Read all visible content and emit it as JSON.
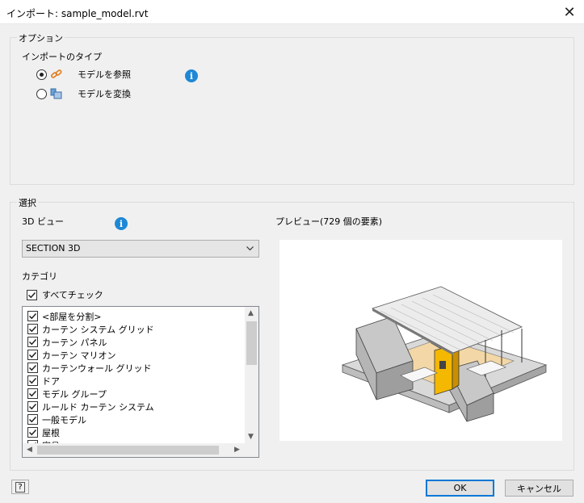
{
  "window": {
    "title": "インポート: sample_model.rvt",
    "close_glyph": "✕"
  },
  "options": {
    "legend": "オプション",
    "import_type_label": "インポートのタイプ",
    "radio_reference": {
      "label": "モデルを参照",
      "checked": true,
      "icon": "link-icon"
    },
    "radio_convert": {
      "label": "モデルを変換",
      "checked": false,
      "icon": "convert-model-icon"
    },
    "info_glyph": "i"
  },
  "selection": {
    "legend": "選択",
    "view_label": "3D ビュー",
    "view_value": "SECTION 3D",
    "category_label": "カテゴリ",
    "check_all_label": "すべてチェック",
    "categories": [
      "<部屋を分割>",
      "カーテン システム グリッド",
      "カーテン パネル",
      "カーテン マリオン",
      "カーテンウォール グリッド",
      "ドア",
      "モデル グループ",
      "ルールド カーテン システム",
      "一般モデル",
      "屋根",
      "家具"
    ],
    "preview_label": "プレビュー(729 個の要素)"
  },
  "buttons": {
    "ok": "OK",
    "cancel": "キャンセル",
    "help": "?"
  },
  "colors": {
    "info_blue": "#1e88d6",
    "default_button_border": "#0078d7",
    "model_accent": "#f5b800"
  }
}
